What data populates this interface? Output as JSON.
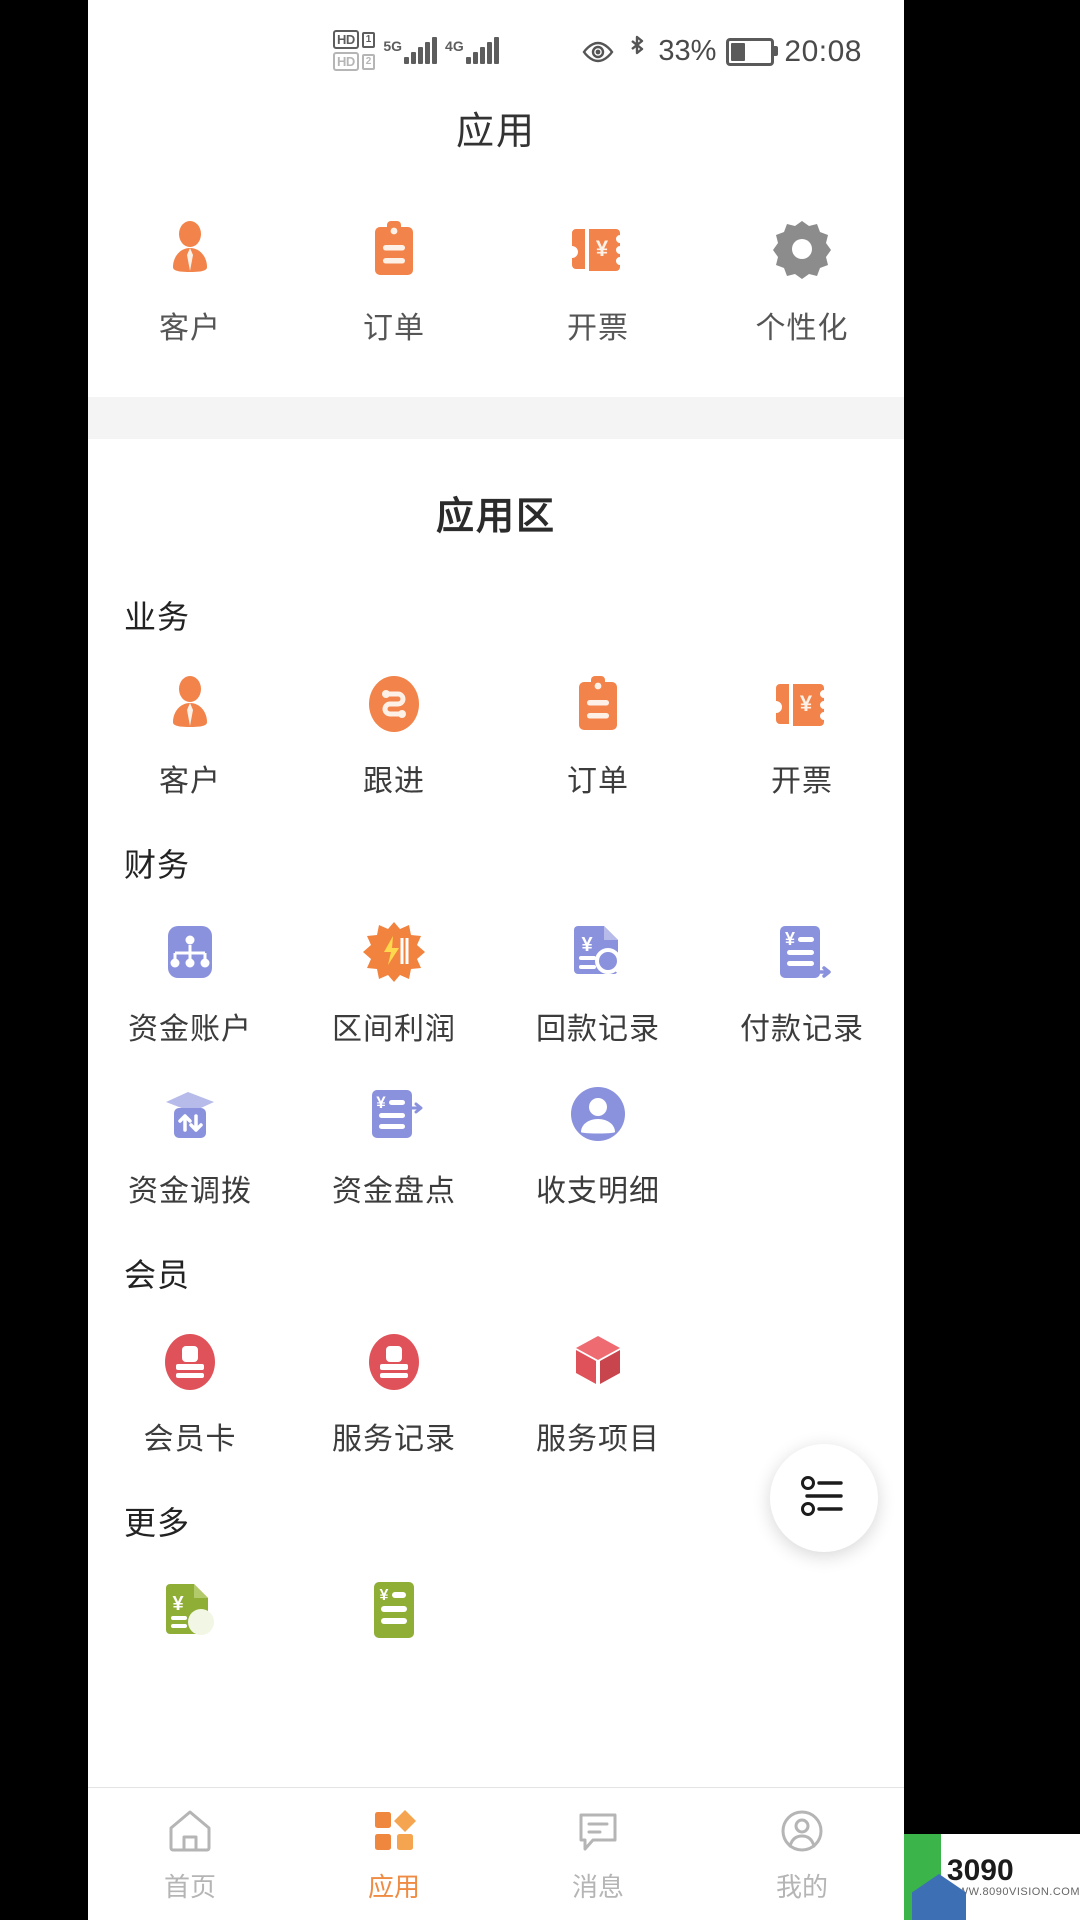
{
  "status_bar": {
    "hd_primary": "HD",
    "sim1": "1",
    "hd_secondary": "HD",
    "sim2": "2",
    "network_primary": "5G",
    "network_secondary": "4G",
    "battery_percent": "33%",
    "battery_level": 33,
    "time": "20:08"
  },
  "header": {
    "title": "应用"
  },
  "quick_apps": [
    {
      "label": "客户",
      "icon": "person-badge-icon",
      "color": "#f2834a"
    },
    {
      "label": "订单",
      "icon": "clipboard-icon",
      "color": "#f2834a"
    },
    {
      "label": "开票",
      "icon": "invoice-ticket-icon",
      "color": "#f2834a"
    },
    {
      "label": "个性化",
      "icon": "gear-icon",
      "color": "#8c8c8c"
    }
  ],
  "zone": {
    "title": "应用区",
    "groups": [
      {
        "name": "业务",
        "items": [
          {
            "label": "客户",
            "icon": "person-badge-icon",
            "color": "#f2834a"
          },
          {
            "label": "跟进",
            "icon": "follow-up-circle-icon",
            "color": "#f2834a"
          },
          {
            "label": "订单",
            "icon": "clipboard-icon",
            "color": "#f2834a"
          },
          {
            "label": "开票",
            "icon": "invoice-ticket-icon",
            "color": "#f2834a"
          }
        ]
      },
      {
        "name": "财务",
        "items": [
          {
            "label": "资金账户",
            "icon": "account-tree-icon",
            "color": "#8a91dd"
          },
          {
            "label": "区间利润",
            "icon": "burst-profit-icon",
            "color": "#f2833f"
          },
          {
            "label": "回款记录",
            "icon": "payment-search-icon",
            "color": "#8a91dd"
          },
          {
            "label": "付款记录",
            "icon": "payment-out-icon",
            "color": "#8a91dd"
          },
          {
            "label": "资金调拨",
            "icon": "transfer-icon",
            "color": "#8a91dd"
          },
          {
            "label": "资金盘点",
            "icon": "stocktake-icon",
            "color": "#8a91dd"
          },
          {
            "label": "收支明细",
            "icon": "person-circle-icon",
            "color": "#8a91dd"
          }
        ]
      },
      {
        "name": "会员",
        "items": [
          {
            "label": "会员卡",
            "icon": "member-stamp-icon",
            "color": "#e0525a"
          },
          {
            "label": "服务记录",
            "icon": "member-stamp-icon",
            "color": "#e0525a"
          },
          {
            "label": "服务项目",
            "icon": "cube-box-icon",
            "color": "#e0525a"
          }
        ]
      },
      {
        "name": "更多",
        "items": [
          {
            "label": "",
            "icon": "receipt-coin-icon",
            "color": "#8fae35"
          },
          {
            "label": "",
            "icon": "ledger-list-icon",
            "color": "#8fae35"
          }
        ]
      }
    ]
  },
  "fab": {
    "icon": "list-menu-icon",
    "label": ""
  },
  "tabbar": [
    {
      "label": "首页",
      "icon": "home-icon",
      "active": false
    },
    {
      "label": "应用",
      "icon": "apps-grid-icon",
      "active": true
    },
    {
      "label": "消息",
      "icon": "message-icon",
      "active": false
    },
    {
      "label": "我的",
      "icon": "profile-icon",
      "active": false
    }
  ],
  "watermark": {
    "title": "3090",
    "subtitle": "WWW.8090VISION.COM"
  },
  "colors": {
    "accent_orange": "#f2834a",
    "purple": "#8a91dd",
    "red": "#e0525a",
    "green": "#8fae35",
    "gray": "#8c8c8c"
  }
}
